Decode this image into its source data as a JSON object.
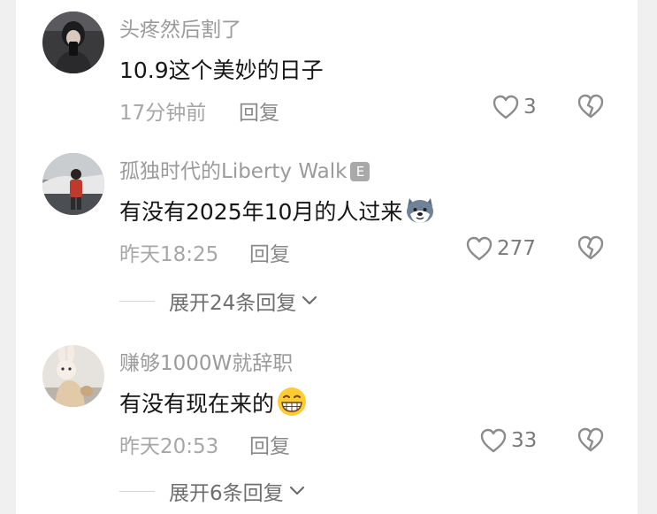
{
  "comments": [
    {
      "username": "头疼然后割了",
      "badge": "",
      "text": "10.9这个美妙的日子",
      "emoji": "",
      "time": "17分钟前",
      "reply_label": "回复",
      "likes": "3",
      "expand_label": ""
    },
    {
      "username": "孤独时代的Liberty Walk",
      "badge": "E",
      "text": "有没有2025年10月的人过来",
      "emoji": "husky-emoji",
      "time": "昨天18:25",
      "reply_label": "回复",
      "likes": "277",
      "expand_label": "展开24条回复"
    },
    {
      "username": "赚够1000W就辞职",
      "badge": "",
      "text": "有没有现在来的",
      "emoji": "grin-emoji",
      "time": "昨天20:53",
      "reply_label": "回复",
      "likes": "33",
      "expand_label": "展开6条回复"
    }
  ],
  "colors": {
    "background": "#f0f0f0",
    "panel": "#ffffff",
    "username": "#9b9b9b",
    "text": "#161616",
    "meta": "#a7a7a7",
    "icon": "#8c8c8c"
  },
  "icons": {
    "like": "heart-outline-icon",
    "dislike": "broken-heart-icon",
    "expand": "chevron-down-icon"
  }
}
